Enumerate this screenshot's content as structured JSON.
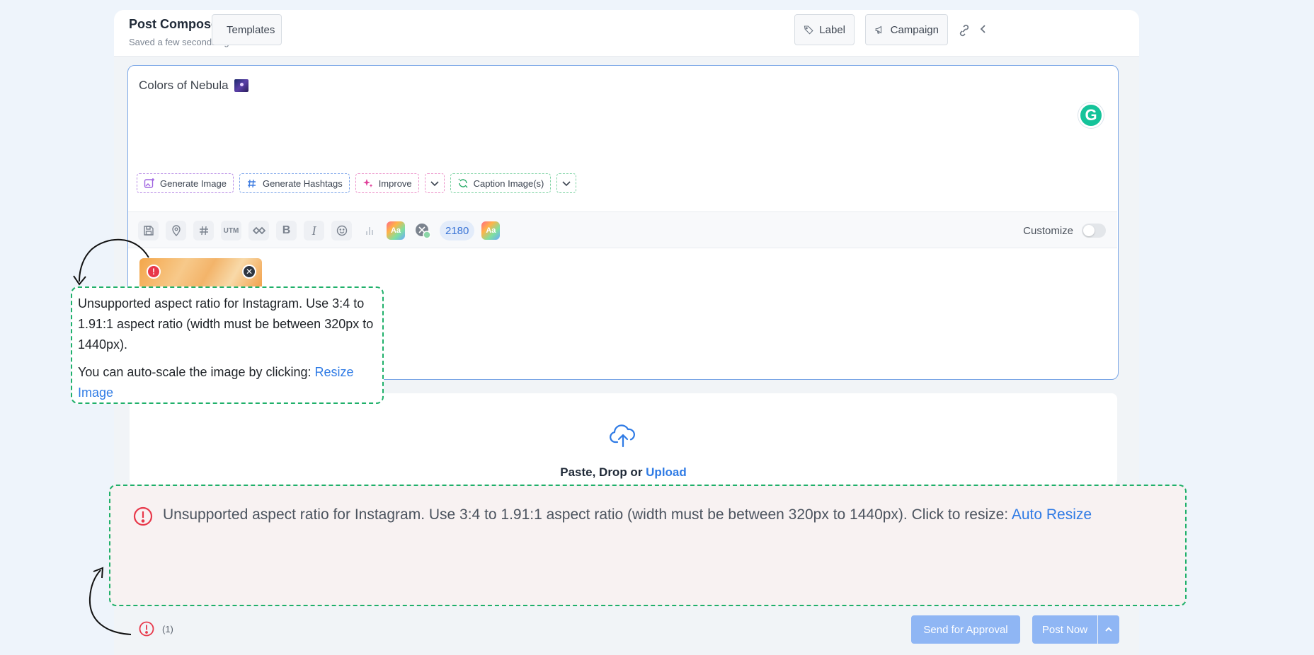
{
  "header": {
    "title": "Post Composer",
    "subtitle": "Saved a few seconds ago",
    "templates_label": "Templates",
    "label_label": "Label",
    "campaign_label": "Campaign"
  },
  "editor": {
    "post_text": "Colors of Nebula",
    "ai_actions": {
      "generate_image": "Generate Image",
      "generate_hashtags": "Generate Hashtags",
      "improve": "Improve",
      "caption_images": "Caption Image(s)"
    },
    "toolbar": {
      "utm": "UTM",
      "bold": "B",
      "italic": "I",
      "aa": "Aa",
      "char_count": "2180",
      "customize_label": "Customize"
    }
  },
  "tooltip": {
    "message": "Unsupported aspect ratio for Instagram. Use 3:4 to 1.91:1 aspect ratio (width must be between 320px to 1440px).",
    "autoscale_text": "You can auto-scale the image by clicking: ",
    "resize_link": "Resize Image"
  },
  "upload": {
    "prefix": "Paste, Drop or ",
    "link": "Upload"
  },
  "error_banner": {
    "message": "Unsupported aspect ratio for Instagram. Use 3:4 to 1.91:1 aspect ratio (width must be between 320px to 1440px). Click to resize: ",
    "link": "Auto Resize"
  },
  "footer": {
    "error_count": "(1)",
    "send_for_approval": "Send for Approval",
    "post_now": "Post Now"
  },
  "colors": {
    "accent": "#2f7be5",
    "annotation_border": "#1fb06a",
    "error": "#e8384a",
    "primary_button": "#8fb6f4"
  }
}
